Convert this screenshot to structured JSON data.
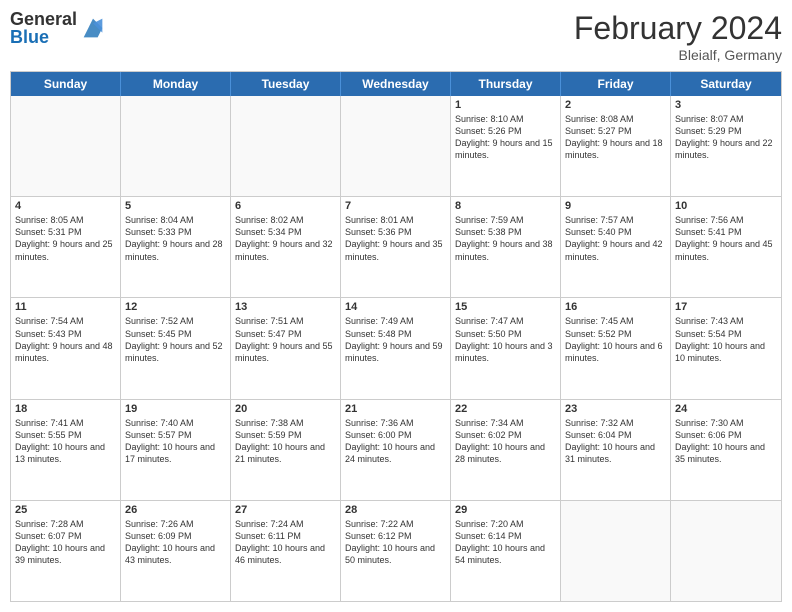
{
  "header": {
    "logo": {
      "general": "General",
      "blue": "Blue"
    },
    "title": "February 2024",
    "subtitle": "Bleialf, Germany"
  },
  "days_of_week": [
    "Sunday",
    "Monday",
    "Tuesday",
    "Wednesday",
    "Thursday",
    "Friday",
    "Saturday"
  ],
  "weeks": [
    [
      {
        "day": "",
        "empty": true
      },
      {
        "day": "",
        "empty": true
      },
      {
        "day": "",
        "empty": true
      },
      {
        "day": "",
        "empty": true
      },
      {
        "day": "1",
        "sunrise": "8:10 AM",
        "sunset": "5:26 PM",
        "daylight": "9 hours and 15 minutes."
      },
      {
        "day": "2",
        "sunrise": "8:08 AM",
        "sunset": "5:27 PM",
        "daylight": "9 hours and 18 minutes."
      },
      {
        "day": "3",
        "sunrise": "8:07 AM",
        "sunset": "5:29 PM",
        "daylight": "9 hours and 22 minutes."
      }
    ],
    [
      {
        "day": "4",
        "sunrise": "8:05 AM",
        "sunset": "5:31 PM",
        "daylight": "9 hours and 25 minutes."
      },
      {
        "day": "5",
        "sunrise": "8:04 AM",
        "sunset": "5:33 PM",
        "daylight": "9 hours and 28 minutes."
      },
      {
        "day": "6",
        "sunrise": "8:02 AM",
        "sunset": "5:34 PM",
        "daylight": "9 hours and 32 minutes."
      },
      {
        "day": "7",
        "sunrise": "8:01 AM",
        "sunset": "5:36 PM",
        "daylight": "9 hours and 35 minutes."
      },
      {
        "day": "8",
        "sunrise": "7:59 AM",
        "sunset": "5:38 PM",
        "daylight": "9 hours and 38 minutes."
      },
      {
        "day": "9",
        "sunrise": "7:57 AM",
        "sunset": "5:40 PM",
        "daylight": "9 hours and 42 minutes."
      },
      {
        "day": "10",
        "sunrise": "7:56 AM",
        "sunset": "5:41 PM",
        "daylight": "9 hours and 45 minutes."
      }
    ],
    [
      {
        "day": "11",
        "sunrise": "7:54 AM",
        "sunset": "5:43 PM",
        "daylight": "9 hours and 48 minutes."
      },
      {
        "day": "12",
        "sunrise": "7:52 AM",
        "sunset": "5:45 PM",
        "daylight": "9 hours and 52 minutes."
      },
      {
        "day": "13",
        "sunrise": "7:51 AM",
        "sunset": "5:47 PM",
        "daylight": "9 hours and 55 minutes."
      },
      {
        "day": "14",
        "sunrise": "7:49 AM",
        "sunset": "5:48 PM",
        "daylight": "9 hours and 59 minutes."
      },
      {
        "day": "15",
        "sunrise": "7:47 AM",
        "sunset": "5:50 PM",
        "daylight": "10 hours and 3 minutes."
      },
      {
        "day": "16",
        "sunrise": "7:45 AM",
        "sunset": "5:52 PM",
        "daylight": "10 hours and 6 minutes."
      },
      {
        "day": "17",
        "sunrise": "7:43 AM",
        "sunset": "5:54 PM",
        "daylight": "10 hours and 10 minutes."
      }
    ],
    [
      {
        "day": "18",
        "sunrise": "7:41 AM",
        "sunset": "5:55 PM",
        "daylight": "10 hours and 13 minutes."
      },
      {
        "day": "19",
        "sunrise": "7:40 AM",
        "sunset": "5:57 PM",
        "daylight": "10 hours and 17 minutes."
      },
      {
        "day": "20",
        "sunrise": "7:38 AM",
        "sunset": "5:59 PM",
        "daylight": "10 hours and 21 minutes."
      },
      {
        "day": "21",
        "sunrise": "7:36 AM",
        "sunset": "6:00 PM",
        "daylight": "10 hours and 24 minutes."
      },
      {
        "day": "22",
        "sunrise": "7:34 AM",
        "sunset": "6:02 PM",
        "daylight": "10 hours and 28 minutes."
      },
      {
        "day": "23",
        "sunrise": "7:32 AM",
        "sunset": "6:04 PM",
        "daylight": "10 hours and 31 minutes."
      },
      {
        "day": "24",
        "sunrise": "7:30 AM",
        "sunset": "6:06 PM",
        "daylight": "10 hours and 35 minutes."
      }
    ],
    [
      {
        "day": "25",
        "sunrise": "7:28 AM",
        "sunset": "6:07 PM",
        "daylight": "10 hours and 39 minutes."
      },
      {
        "day": "26",
        "sunrise": "7:26 AM",
        "sunset": "6:09 PM",
        "daylight": "10 hours and 43 minutes."
      },
      {
        "day": "27",
        "sunrise": "7:24 AM",
        "sunset": "6:11 PM",
        "daylight": "10 hours and 46 minutes."
      },
      {
        "day": "28",
        "sunrise": "7:22 AM",
        "sunset": "6:12 PM",
        "daylight": "10 hours and 50 minutes."
      },
      {
        "day": "29",
        "sunrise": "7:20 AM",
        "sunset": "6:14 PM",
        "daylight": "10 hours and 54 minutes."
      },
      {
        "day": "",
        "empty": true
      },
      {
        "day": "",
        "empty": true
      }
    ]
  ]
}
